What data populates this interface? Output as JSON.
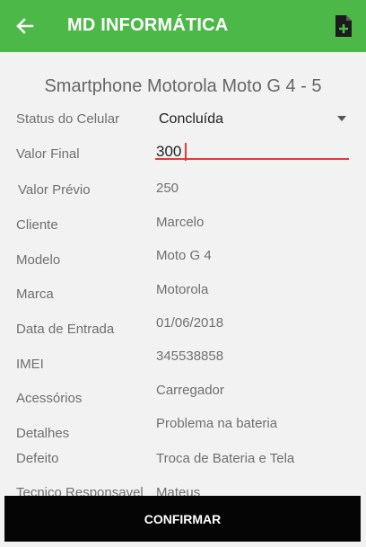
{
  "appbar": {
    "title": "MD INFORMÁTICA",
    "back_icon": "arrow-left-icon",
    "action_icon": "add-document-icon",
    "color": "#4cb847"
  },
  "product": {
    "title": "Smartphone Motorola Moto G 4 - 5"
  },
  "form": {
    "status": {
      "label": "Status do Celular",
      "value": "Concluída"
    },
    "final_value": {
      "label": "Valor Final",
      "value": "300"
    }
  },
  "details": [
    {
      "label": "Valor Prévio",
      "value": "250"
    },
    {
      "label": "Cliente",
      "value": "Marcelo"
    },
    {
      "label": "Modelo",
      "value": "Moto G 4"
    },
    {
      "label": "Marca",
      "value": "Motorola"
    },
    {
      "label": "Data de Entrada",
      "value": "01/06/2018"
    },
    {
      "label": "IMEI",
      "value": "345538858"
    },
    {
      "label": "Acessórios",
      "value": "Carregador"
    },
    {
      "label": "Detalhes",
      "value": "Problema na bateria"
    },
    {
      "label": "Defeito",
      "value": "Troca de Bateria e Tela"
    },
    {
      "label": "Tecnico Responsavel",
      "value": "Mateus"
    }
  ],
  "confirm_label": "CONFIRMAR",
  "accent_color": "#e53935"
}
